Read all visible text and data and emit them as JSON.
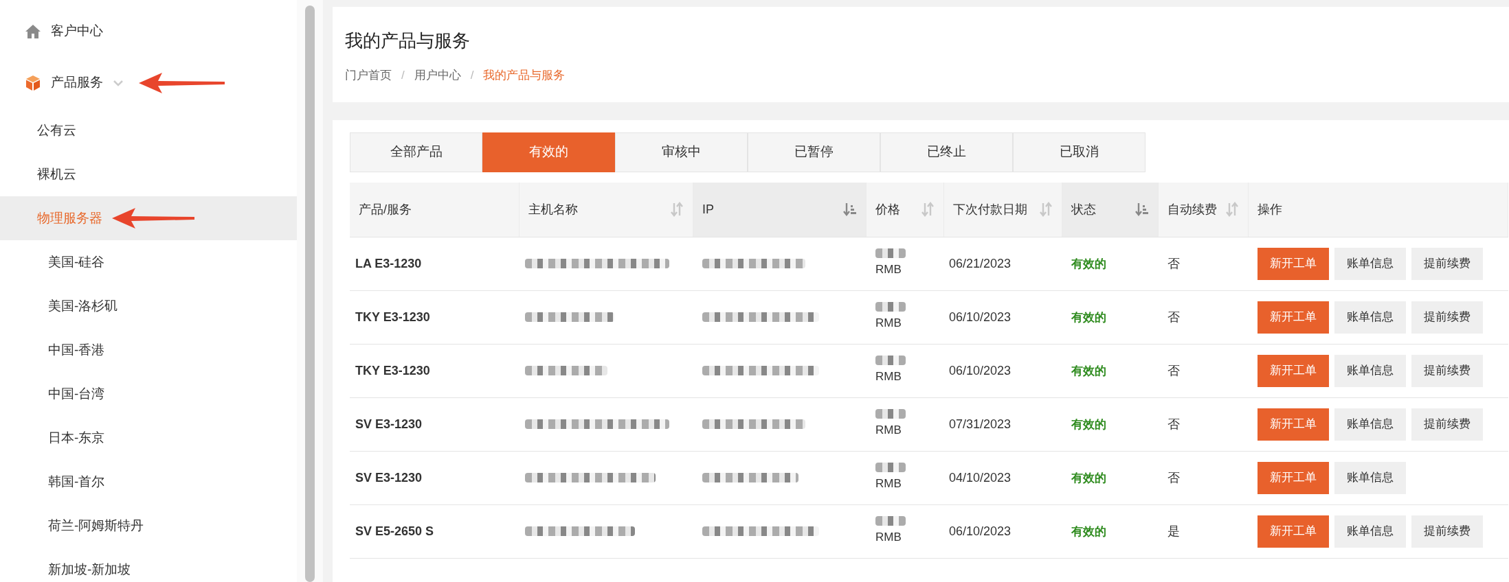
{
  "sidebar": {
    "items": [
      {
        "label": "客户中心",
        "selected": false
      },
      {
        "label": "产品服务",
        "selected": false,
        "expanded": true,
        "annotated": true,
        "children": [
          {
            "label": "公有云",
            "selected": false,
            "annotated": false
          },
          {
            "label": "裸机云",
            "selected": false,
            "annotated": false
          },
          {
            "label": "物理服务器",
            "selected": true,
            "annotated": true,
            "children": [
              {
                "label": "美国-硅谷",
                "selected": false
              },
              {
                "label": "美国-洛杉矶",
                "selected": false
              },
              {
                "label": "中国-香港",
                "selected": false
              },
              {
                "label": "中国-台湾",
                "selected": false
              },
              {
                "label": "日本-东京",
                "selected": false
              },
              {
                "label": "韩国-首尔",
                "selected": false
              },
              {
                "label": "荷兰-阿姆斯特丹",
                "selected": false
              },
              {
                "label": "新加坡-新加坡",
                "selected": false
              }
            ]
          }
        ]
      }
    ]
  },
  "header": {
    "title": "我的产品与服务",
    "breadcrumb": [
      {
        "label": "门户首页",
        "current": false
      },
      {
        "label": "用户中心",
        "current": false
      },
      {
        "label": "我的产品与服务",
        "current": true
      }
    ],
    "separator": "/"
  },
  "tabs": [
    {
      "label": "全部产品",
      "selected": false
    },
    {
      "label": "有效的",
      "selected": true
    },
    {
      "label": "审核中",
      "selected": false
    },
    {
      "label": "已暂停",
      "selected": false
    },
    {
      "label": "已终止",
      "selected": false
    },
    {
      "label": "已取消",
      "selected": false
    }
  ],
  "table": {
    "columns": [
      {
        "label": "产品/服务",
        "sortable": false
      },
      {
        "label": "主机名称",
        "sortable": true,
        "sorted": false
      },
      {
        "label": "IP",
        "sortable": true,
        "sorted": true
      },
      {
        "label": "价格",
        "sortable": true,
        "sorted": false
      },
      {
        "label": "下次付款日期",
        "sortable": true,
        "sorted": false
      },
      {
        "label": "状态",
        "sortable": true,
        "sorted": true
      },
      {
        "label": "自动续费",
        "sortable": true,
        "sorted": false
      },
      {
        "label": "操作",
        "sortable": false
      }
    ],
    "rows": [
      {
        "product": "LA E3-1230",
        "price_unit": "RMB",
        "next_due": "06/21/2023",
        "status": "有效的",
        "auto_renew": "否",
        "actions": [
          {
            "label": "新开工单",
            "kind": "primary"
          },
          {
            "label": "账单信息",
            "kind": "secondary"
          },
          {
            "label": "提前续费",
            "kind": "secondary"
          }
        ]
      },
      {
        "product": "TKY E3-1230",
        "price_unit": "RMB",
        "next_due": "06/10/2023",
        "status": "有效的",
        "auto_renew": "否",
        "actions": [
          {
            "label": "新开工单",
            "kind": "primary"
          },
          {
            "label": "账单信息",
            "kind": "secondary"
          },
          {
            "label": "提前续费",
            "kind": "secondary"
          }
        ]
      },
      {
        "product": "TKY E3-1230",
        "price_unit": "RMB",
        "next_due": "06/10/2023",
        "status": "有效的",
        "auto_renew": "否",
        "actions": [
          {
            "label": "新开工单",
            "kind": "primary"
          },
          {
            "label": "账单信息",
            "kind": "secondary"
          },
          {
            "label": "提前续费",
            "kind": "secondary"
          }
        ]
      },
      {
        "product": "SV E3-1230",
        "price_unit": "RMB",
        "next_due": "07/31/2023",
        "status": "有效的",
        "auto_renew": "否",
        "actions": [
          {
            "label": "新开工单",
            "kind": "primary"
          },
          {
            "label": "账单信息",
            "kind": "secondary"
          },
          {
            "label": "提前续费",
            "kind": "secondary"
          }
        ]
      },
      {
        "product": "SV E3-1230",
        "price_unit": "RMB",
        "next_due": "04/10/2023",
        "status": "有效的",
        "auto_renew": "否",
        "actions": [
          {
            "label": "新开工单",
            "kind": "primary"
          },
          {
            "label": "账单信息",
            "kind": "secondary"
          }
        ]
      },
      {
        "product": "SV E5-2650 S",
        "price_unit": "RMB",
        "next_due": "06/10/2023",
        "status": "有效的",
        "auto_renew": "是",
        "actions": [
          {
            "label": "新开工单",
            "kind": "primary"
          },
          {
            "label": "账单信息",
            "kind": "secondary"
          },
          {
            "label": "提前续费",
            "kind": "secondary"
          }
        ]
      }
    ]
  }
}
